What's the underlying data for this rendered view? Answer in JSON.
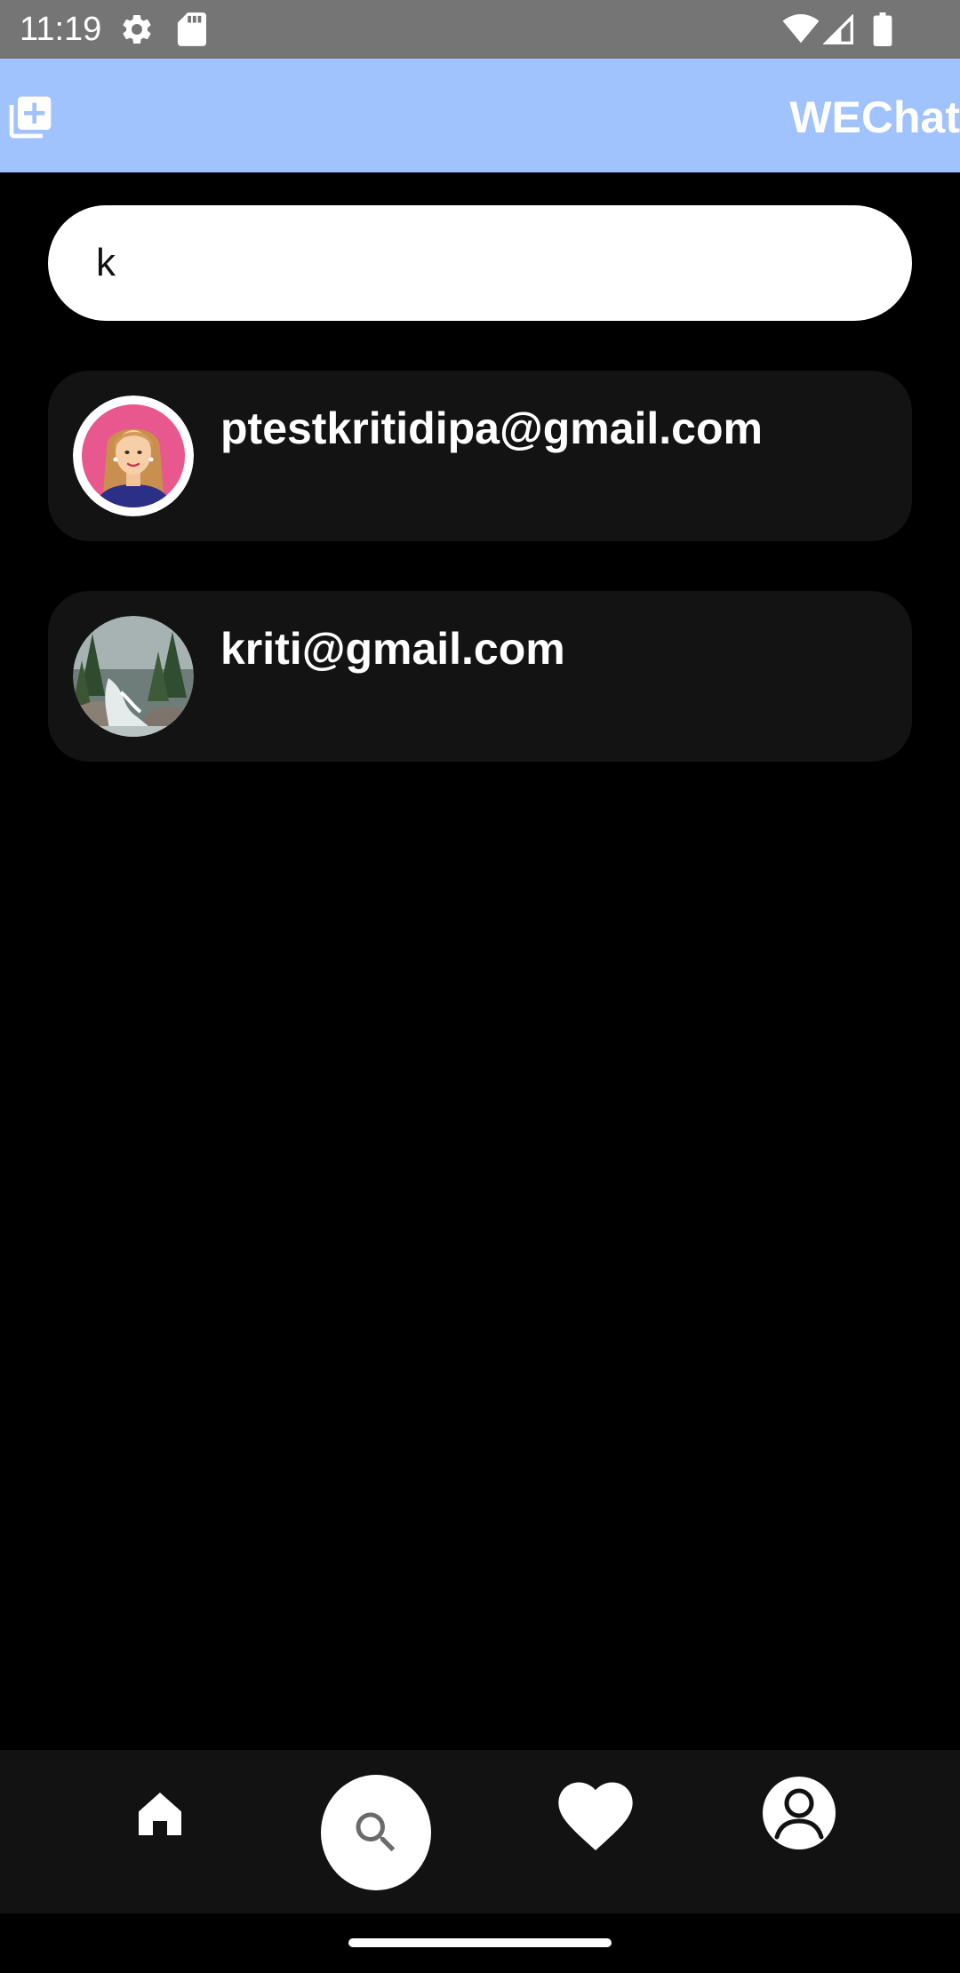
{
  "status_bar": {
    "time": "11:19",
    "icons": [
      "settings-gear-icon",
      "sd-card-icon",
      "wifi-icon",
      "cell-signal-icon",
      "battery-icon"
    ]
  },
  "app_bar": {
    "title": "WEChat",
    "add_icon": "add-box-icon",
    "color": "#a0c2fd"
  },
  "search": {
    "value": "k",
    "placeholder": ""
  },
  "results": [
    {
      "email": "ptestkritidipa@gmail.com",
      "avatar": "woman-illustration-avatar"
    },
    {
      "email": "kriti@gmail.com",
      "avatar": "waterfall-photo-avatar"
    }
  ],
  "bottom_nav": {
    "items": [
      {
        "icon": "home-icon"
      },
      {
        "icon": "search-icon",
        "selected": true
      },
      {
        "icon": "heart-icon"
      },
      {
        "icon": "profile-icon"
      }
    ]
  },
  "colors": {
    "background": "#000000",
    "card": "#131313",
    "nav": "#121212",
    "status_bar": "#757575"
  }
}
